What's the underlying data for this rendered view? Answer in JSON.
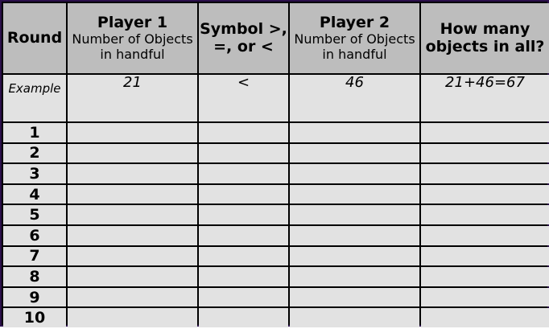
{
  "headers": {
    "round": "Round",
    "player1_title": "Player 1",
    "player1_sub": "Number of Objects in handful",
    "symbol": "Symbol >, =, or <",
    "player2_title": "Player 2",
    "player2_sub": "Number of Objects in handful",
    "total": "How many objects in all?"
  },
  "example": {
    "label": "Example",
    "player1": "21",
    "symbol": "<",
    "player2": "46",
    "total": "21+46=67"
  },
  "rounds": [
    "1",
    "2",
    "3",
    "4",
    "5",
    "6",
    "7",
    "8",
    "9",
    "10"
  ],
  "colors": {
    "header_bg": "#bdbdbd",
    "cell_bg": "#e2e2e2",
    "grid": "#000000",
    "frame": "#2b0f4a"
  }
}
